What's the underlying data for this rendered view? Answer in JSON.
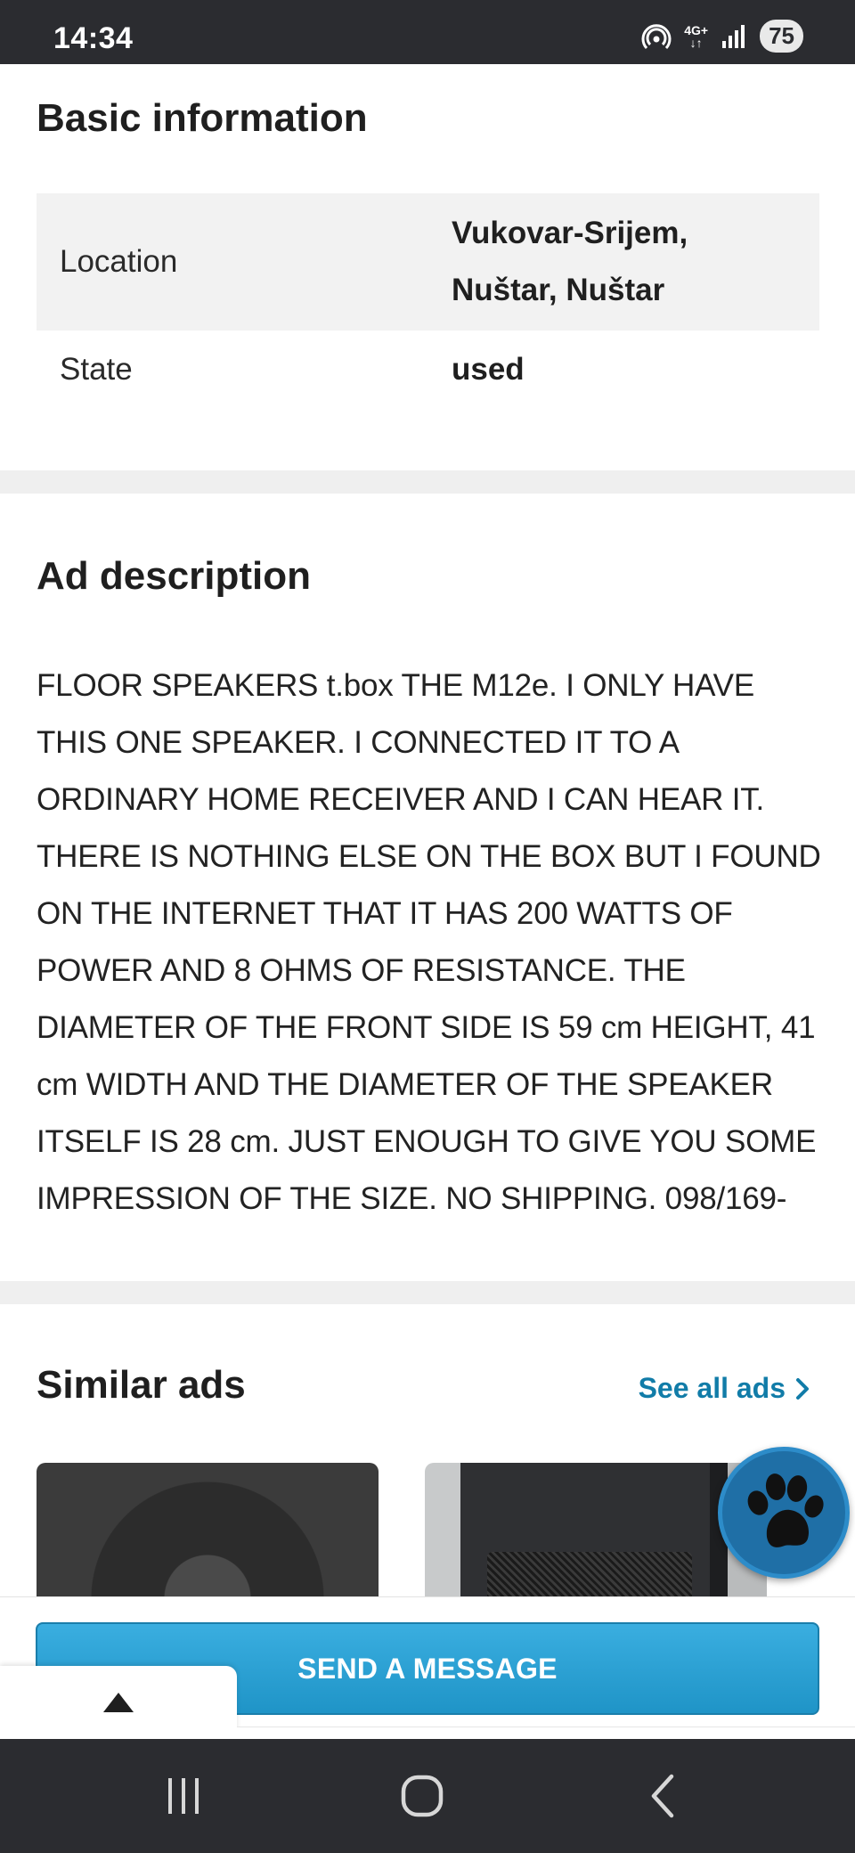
{
  "status_bar": {
    "time": "14:34",
    "network": "4G+",
    "battery": "75"
  },
  "basic_info": {
    "title": "Basic information",
    "rows": [
      {
        "label": "Location",
        "value_line1": "Vukovar-Srijem,",
        "value_line2": "Nuštar, Nuštar"
      },
      {
        "label": "State",
        "value": "used"
      }
    ]
  },
  "ad_description": {
    "title": "Ad description",
    "text": "FLOOR SPEAKERS t.box THE M12e. I ONLY HAVE THIS ONE SPEAKER. I CONNECTED IT TO A ORDINARY HOME RECEIVER AND I CAN HEAR IT. THERE IS NOTHING ELSE ON THE BOX BUT I FOUND ON THE INTERNET THAT IT HAS 200 WATTS OF POWER AND 8 OHMS OF RESISTANCE. THE DIAMETER OF THE FRONT SIDE IS 59 cm HEIGHT, 41 cm WIDTH AND THE DIAMETER OF THE SPEAKER ITSELF IS 28 cm. JUST ENOUGH TO GIVE YOU SOME IMPRESSION OF THE SIZE. NO SHIPPING. 098/169-"
  },
  "similar_ads": {
    "title": "Similar ads",
    "see_all_label": "See all ads",
    "items": [
      {
        "image_icon": "speaker-woofer-image"
      },
      {
        "image_icon": "speaker-cabinet-image"
      }
    ]
  },
  "actions": {
    "send_message_label": "SEND A MESSAGE"
  },
  "colors": {
    "accent_link": "#117ca8",
    "button_blue": "#2aa3d8",
    "fab_blue": "#1f6fa6",
    "system_bar": "#2b2c30"
  }
}
